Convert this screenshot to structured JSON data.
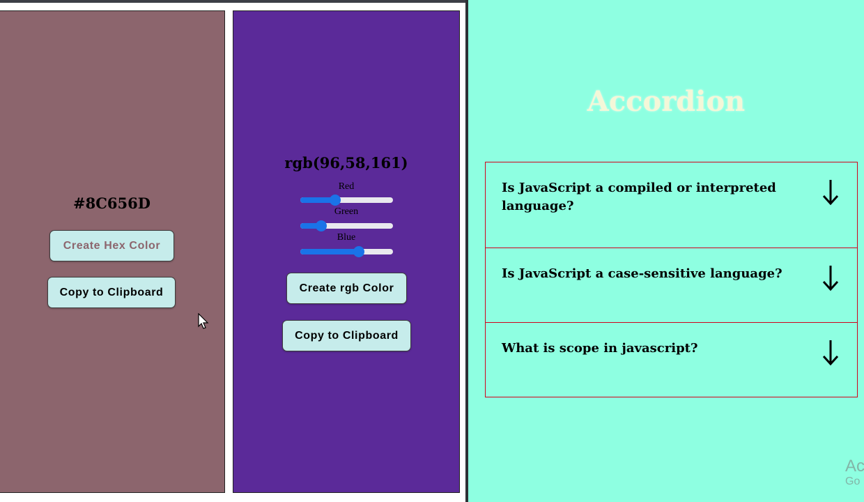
{
  "hex_panel": {
    "value": "#8C656D",
    "create_label": "Create Hex Color",
    "copy_label": "Copy to Clipboard",
    "background": "#8c656d"
  },
  "rgb_panel": {
    "value": "rgb(96,58,161)",
    "sliders": [
      {
        "label": "Red",
        "value": 96,
        "max": 255
      },
      {
        "label": "Green",
        "value": 58,
        "max": 255
      },
      {
        "label": "Blue",
        "value": 161,
        "max": 255
      }
    ],
    "create_label": "Create rgb Color",
    "copy_label": "Copy to Clipboard",
    "background": "#5b2a99"
  },
  "accordion": {
    "title": "Accordion",
    "items": [
      {
        "question": "Is JavaScript a compiled or interpreted language?",
        "icon": "arrow-down-icon"
      },
      {
        "question": "Is JavaScript a case-sensitive language?",
        "icon": "arrow-down-icon"
      },
      {
        "question": "What is scope in javascript?",
        "icon": "arrow-down-icon"
      }
    ],
    "background": "#8effe1",
    "border_color": "#d0021b"
  },
  "watermark": {
    "line1": "Ac",
    "line2": "Go"
  }
}
